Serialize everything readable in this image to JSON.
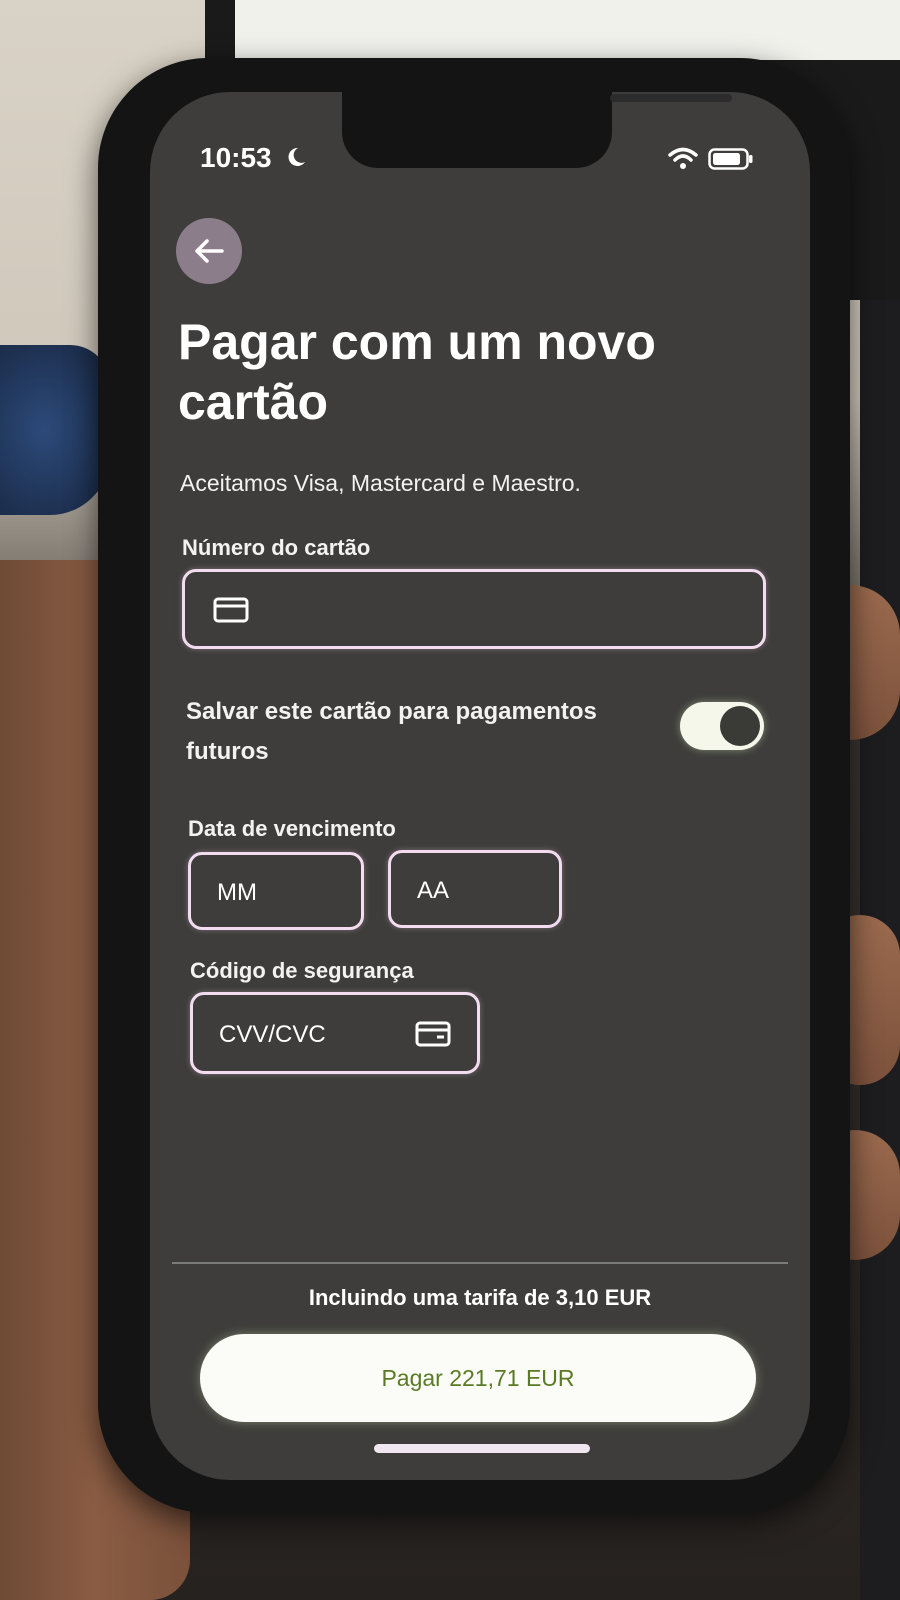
{
  "status_bar": {
    "time": "10:53",
    "icons": [
      "moon-icon",
      "wifi-icon",
      "battery-icon"
    ]
  },
  "header": {
    "back_icon": "arrow-left-icon",
    "title": "Pagar com um novo cartão",
    "subtitle": "Aceitamos Visa, Mastercard e Maestro."
  },
  "form": {
    "card_number": {
      "label": "Número do cartão",
      "placeholder": "",
      "icon": "card-icon"
    },
    "save_card": {
      "label": "Salvar este cartão para pagamentos futuros",
      "enabled": true
    },
    "expiry": {
      "label": "Data de vencimento",
      "month_placeholder": "MM",
      "year_placeholder": "AA"
    },
    "security_code": {
      "label": "Código de segurança",
      "placeholder": "CVV/CVC",
      "icon": "card-back-icon"
    }
  },
  "footer": {
    "fee_text": "Incluindo uma tarifa de 3,10 EUR",
    "pay_button_label": "Pagar 221,71 EUR"
  },
  "colors": {
    "screen_bg": "#3e3d3b",
    "input_border": "#f3dcef",
    "pay_text": "#5a7a24",
    "toggle_on": "#f4f7ea"
  }
}
